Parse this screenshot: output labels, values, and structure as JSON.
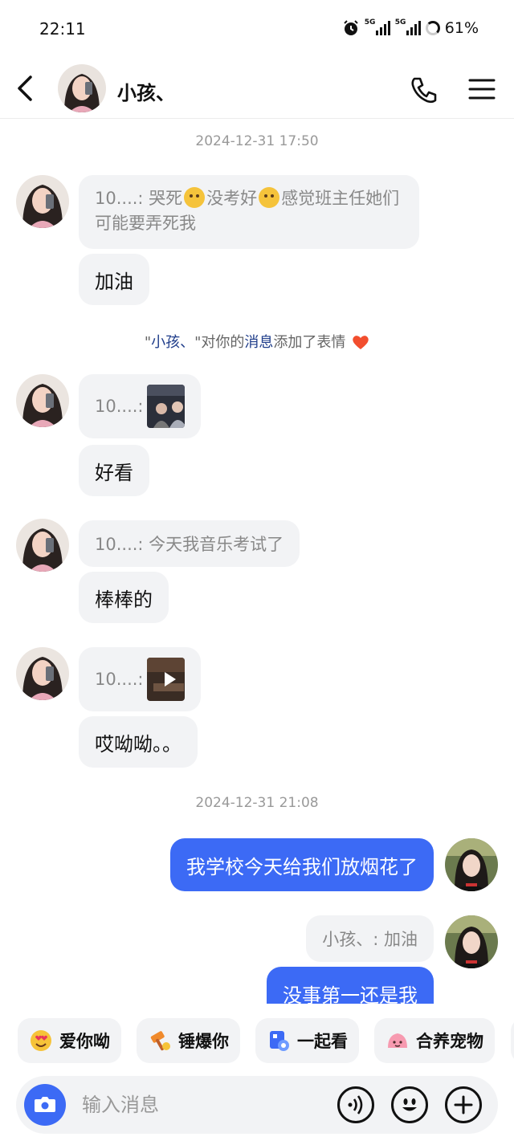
{
  "status_bar": {
    "time": "22:11",
    "net1": "5G",
    "net2": "5G",
    "battery": "61%"
  },
  "header": {
    "title": "小孩、"
  },
  "timestamps": {
    "t1": "2024-12-31 17:50",
    "t2": "2024-12-31 21:08"
  },
  "messages": {
    "q1": {
      "prefix": "10....: 哭死",
      "mid": "没考好",
      "suffix": "感觉班主任她们可能要弄死我"
    },
    "r1": "加油",
    "sys": {
      "q1": "\"",
      "name": "小孩、",
      "q2": "\"对你的",
      "link": "消息",
      "rest": "添加了表情"
    },
    "q2": "10....:",
    "r2": "好看",
    "q3": "10....: 今天我音乐考试了",
    "r3": "棒棒的",
    "q4": "10....:",
    "r4": "哎呦呦。。",
    "mine1": "我学校今天给我们放烟花了",
    "mine_quote": "小孩、: 加油",
    "mine2": "没事第一还是我"
  },
  "quick_actions": [
    "爱你呦",
    "锤爆你",
    "一起看",
    "合养宠物"
  ],
  "input": {
    "placeholder": "输入消息"
  },
  "colors": {
    "accent": "#3c6af5",
    "bubble": "#f2f3f5"
  }
}
